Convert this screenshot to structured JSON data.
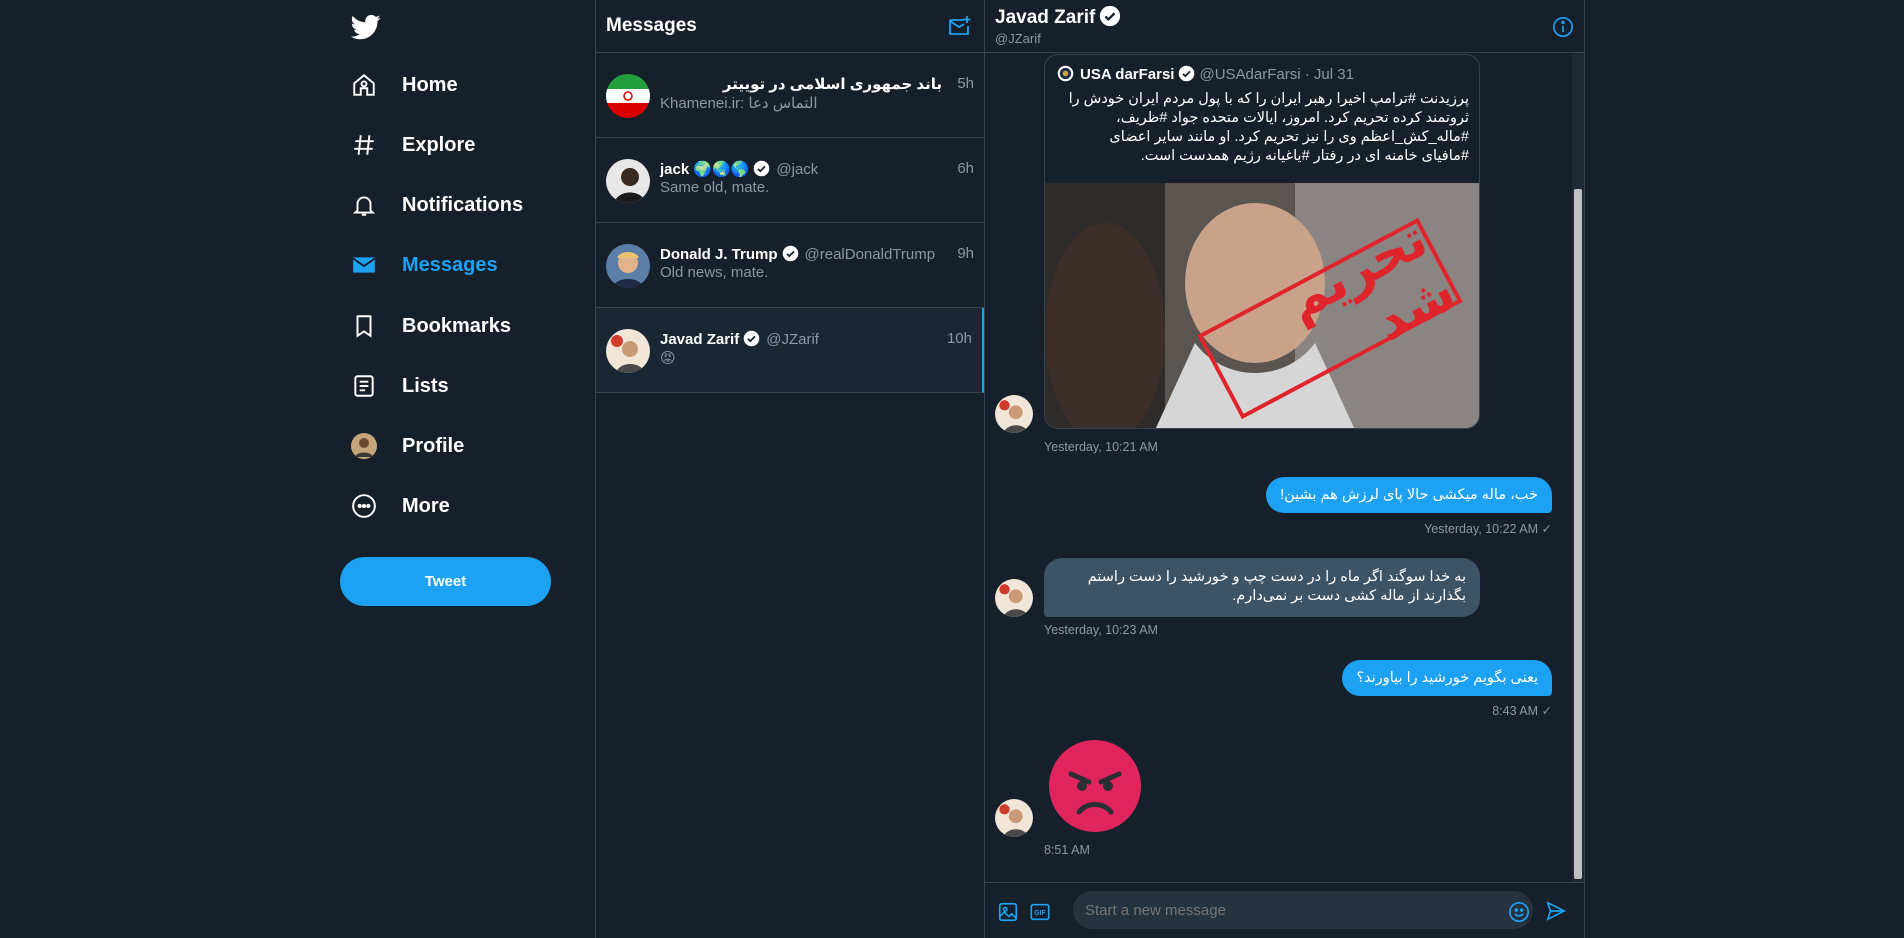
{
  "nav": {
    "items": [
      {
        "label": "Home",
        "icon": "home-icon"
      },
      {
        "label": "Explore",
        "icon": "hashtag-icon"
      },
      {
        "label": "Notifications",
        "icon": "bell-icon"
      },
      {
        "label": "Messages",
        "icon": "envelope-icon"
      },
      {
        "label": "Bookmarks",
        "icon": "bookmark-icon"
      },
      {
        "label": "Lists",
        "icon": "list-icon"
      },
      {
        "label": "Profile",
        "icon": "avatar"
      },
      {
        "label": "More",
        "icon": "more-icon"
      }
    ],
    "active": "Messages",
    "tweet_label": "Tweet"
  },
  "messages": {
    "title": "Messages",
    "conversations": [
      {
        "name": "باند جمهوری اسلامی در توییتر",
        "handle": "",
        "time": "5h",
        "snippet": "Khamenei.ir: التماس دعا"
      },
      {
        "name": "jack 🌍🌏🌎",
        "handle": "@jack",
        "time": "6h",
        "snippet": "Same old, mate."
      },
      {
        "name": "Donald J. Trump",
        "handle": "@realDonaldTrump",
        "time": "9h",
        "snippet": "Old news, mate."
      },
      {
        "name": "Javad Zarif",
        "handle": "@JZarif",
        "time": "10h",
        "snippet": "😡"
      }
    ]
  },
  "chat": {
    "title": "Javad Zarif",
    "handle": "@JZarif",
    "card": {
      "name": "USA darFarsi",
      "meta": "@USAdarFarsi · Jul 31",
      "text": "پرزیدنت #ترامپ اخیرا رهبر ایران را که با پول مردم ایران خودش را ثروتمند کرده تحریم کرد.  امروز، ایالات متحده جواد #ظریف، #ماله_کش_اعظم وی را نیز تحریم کرد.  او مانند سایر اعضای #مافیای خامنه ای در رفتار #یاغیانه رژیم همدست است.",
      "stamp": "تحریم شد"
    },
    "ts1": "Yesterday, 10:21 AM",
    "out1": "خب، ماله میکشی حالا پای لرزش هم بشین!",
    "ts2": "Yesterday, 10:22 AM ✓",
    "in1": "به خدا سوگند اگر ماه را در دست چپ و خورشید را دست راستم بگذارند از ماله کشی دست بر نمی‌دارم.",
    "ts3": "Yesterday, 10:23 AM",
    "out2": "یعنی بگویم خورشید را بیاورند؟",
    "ts4": "8:43 AM ✓",
    "ts5": "8:51 AM",
    "placeholder": "Start a new message"
  },
  "colors": {
    "background": "#15202b",
    "accent": "#1da1f2",
    "border": "#38444d",
    "muted": "#8899a6"
  }
}
